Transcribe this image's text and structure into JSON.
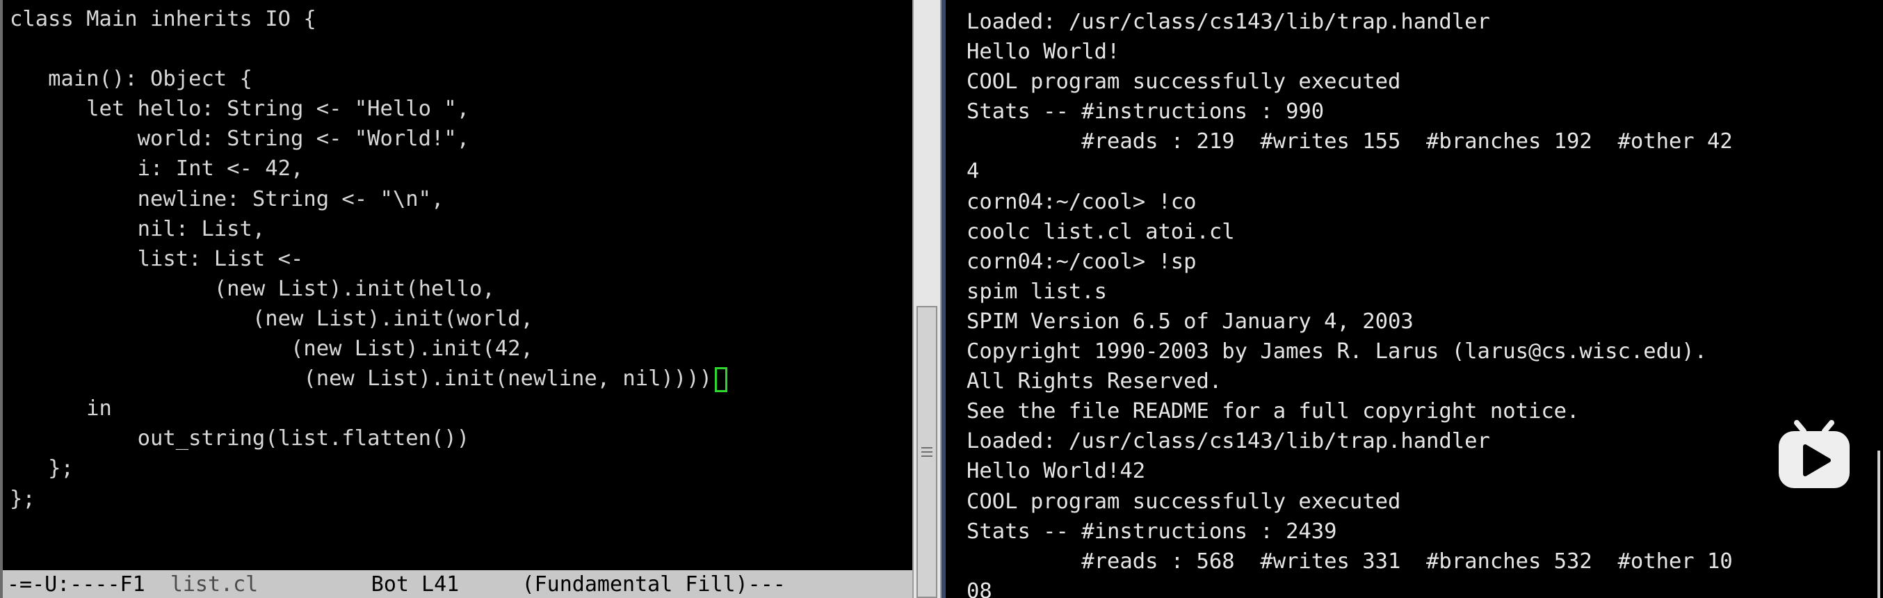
{
  "editor": {
    "lines": [
      "class Main inherits IO {",
      "",
      "   main(): Object {",
      "      let hello: String <- \"Hello \",",
      "          world: String <- \"World!\",",
      "          i: Int <- 42,",
      "          newline: String <- \"\\n\",",
      "          nil: List,",
      "          list: List <-",
      "                (new List).init(hello,",
      "                   (new List).init(world,",
      "                      (new List).init(42,",
      "                       (new List).init(newline, nil))))",
      "      in",
      "          out_string(list.flatten())",
      "   };",
      "};"
    ],
    "modeline": {
      "prefix": "-=-U:----F1  ",
      "filename": "list.cl",
      "suffix": "         Bot L41     (Fundamental Fill)---"
    },
    "cursor_color": "#2fd62f"
  },
  "terminal": {
    "lines": [
      "Loaded: /usr/class/cs143/lib/trap.handler",
      "Hello World!",
      "COOL program successfully executed",
      "Stats -- #instructions : 990",
      "         #reads : 219  #writes 155  #branches 192  #other 42",
      "4",
      "corn04:~/cool> !co",
      "coolc list.cl atoi.cl",
      "corn04:~/cool> !sp",
      "spim list.s",
      "SPIM Version 6.5 of January 4, 2003",
      "Copyright 1990-2003 by James R. Larus (larus@cs.wisc.edu).",
      "All Rights Reserved.",
      "See the file README for a full copyright notice.",
      "Loaded: /usr/class/cs143/lib/trap.handler",
      "Hello World!42",
      "COOL program successfully executed",
      "Stats -- #instructions : 2439",
      "         #reads : 568  #writes 331  #branches 532  #other 10",
      "08"
    ]
  },
  "overlay": {
    "icon": "video-play-icon"
  }
}
